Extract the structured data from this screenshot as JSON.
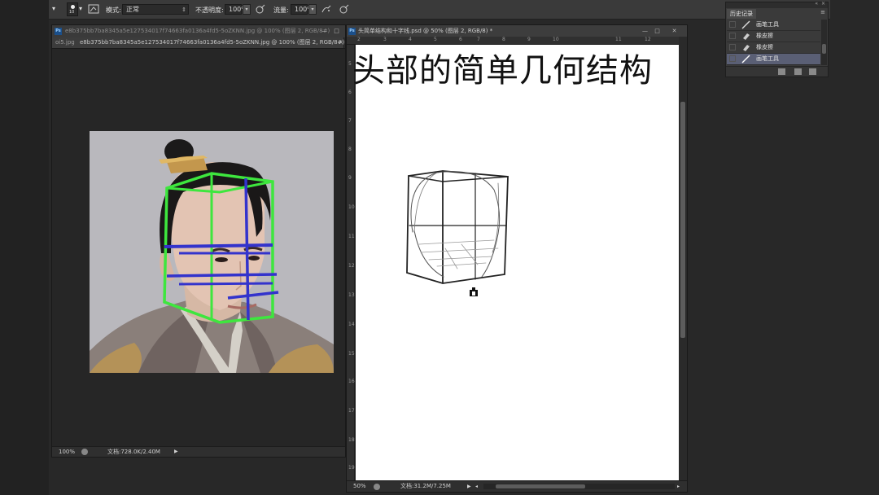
{
  "options_bar": {
    "brush_size": "10",
    "mode_label": "模式:",
    "mode_value": "正常",
    "opacity_label": "不透明度:",
    "opacity_value": "100%",
    "flow_label": "流量:",
    "flow_value": "100%"
  },
  "left_document": {
    "title": "e8b375bb7ba8345a5e127534017f74663fa0136a4fd5-5oZKNN.jpg @ 100% (图层 2, RGB/8#)",
    "tab_prev": "oi5.jpg",
    "tab_active": "e8b375bb7ba8345a5e127534017f74663fa0136a4fd5-5oZKNN.jpg @ 100% (图层 2, RGB/8#) *",
    "zoom": "100%",
    "doc_info": "文档:728.0K/2.40M"
  },
  "right_document": {
    "title": "头简单结构和十字线.psd @ 50% (图层 2, RGB/8) *",
    "canvas_heading": "头部的简单几何结构",
    "zoom": "50%",
    "doc_info": "文档:31.2M/7.25M",
    "ruler_h": [
      "2",
      "3",
      "4",
      "5",
      "6",
      "7",
      "8",
      "9",
      "10",
      "11",
      "12"
    ],
    "ruler_v": [
      "5",
      "6",
      "7",
      "8",
      "9",
      "10",
      "11",
      "12",
      "13",
      "14",
      "15",
      "16",
      "17",
      "18",
      "19"
    ]
  },
  "history_panel": {
    "tab_label": "历史记录",
    "items": [
      {
        "label": "画笔工具",
        "icon": "brush-icon",
        "selected": false
      },
      {
        "label": "橡皮擦",
        "icon": "eraser-icon",
        "selected": false
      },
      {
        "label": "橡皮擦",
        "icon": "eraser-icon",
        "selected": false
      },
      {
        "label": "画笔工具",
        "icon": "brush-icon",
        "selected": true
      }
    ]
  },
  "colors": {
    "ui_dark": "#282828",
    "panel": "#3a3a3a",
    "guide_green": "#3ee63e",
    "guide_blue": "#3333cc",
    "selection": "#5a5f75"
  }
}
